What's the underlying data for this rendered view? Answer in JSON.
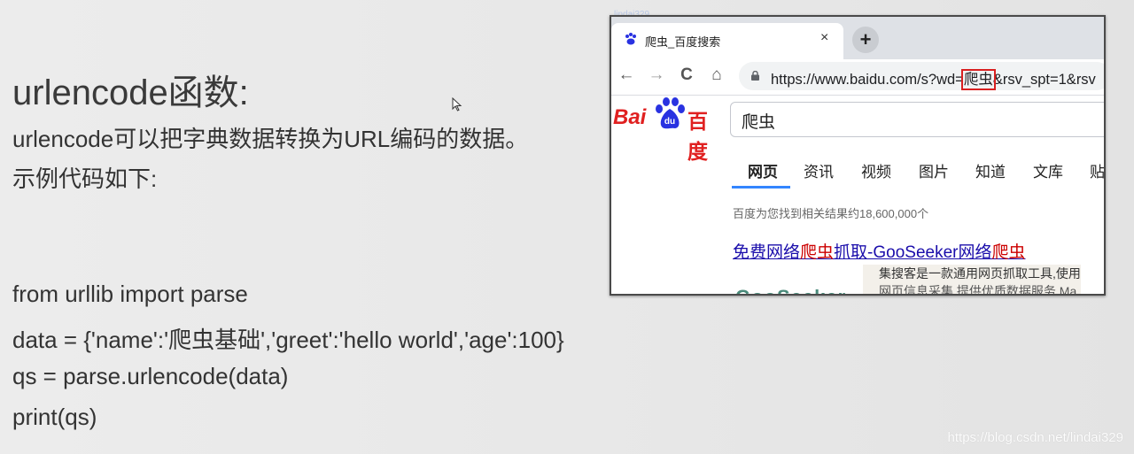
{
  "slide": {
    "title": "urlencode函数:",
    "lines": [
      "urlencode可以把字典数据转换为URL编码的数据。",
      "示例代码如下:"
    ],
    "code": [
      "from urllib import parse",
      "data = {'name':'爬虫基础','greet':'hello world','age':100}",
      "qs = parse.urlencode(data)",
      "print(qs)"
    ],
    "watermark": "https://blog.csdn.net/lindai329",
    "faint_label": "lindai329"
  },
  "browser": {
    "tab_title": "爬虫_百度搜索",
    "tab_close": "×",
    "new_tab": "+",
    "nav": {
      "back": "←",
      "forward": "→",
      "reload": "C",
      "home": "⌂"
    },
    "url_prefix": "https://www.baidu.com/s?wd=",
    "url_highlight": "爬虫",
    "url_suffix": "&rsv_spt=1&rsv",
    "logo": {
      "bai": "Bai",
      "du": "du",
      "cn": "百度"
    },
    "search_query": "爬虫",
    "tabs": [
      "网页",
      "资讯",
      "视频",
      "图片",
      "知道",
      "文库",
      "贴"
    ],
    "active_tab": "网页",
    "result_count": "百度为您找到相关结果约18,600,000个",
    "result_title": {
      "a": "免费网络",
      "b": "爬虫",
      "c": "抓取-GooSeeker网络",
      "d": "爬虫"
    },
    "snippet_1": "集搜客是一款通用网页抓取工具,使用",
    "snippet_2": "网页信息采集,提供优质数据服务,Ma",
    "partial_heading": "GooSeeker"
  },
  "colors": {
    "baidu_red": "#e02020",
    "baidu_blue": "#2932e1",
    "link": "#1a0dab",
    "tab_accent": "#3385ff",
    "url_box": "#d92020"
  }
}
